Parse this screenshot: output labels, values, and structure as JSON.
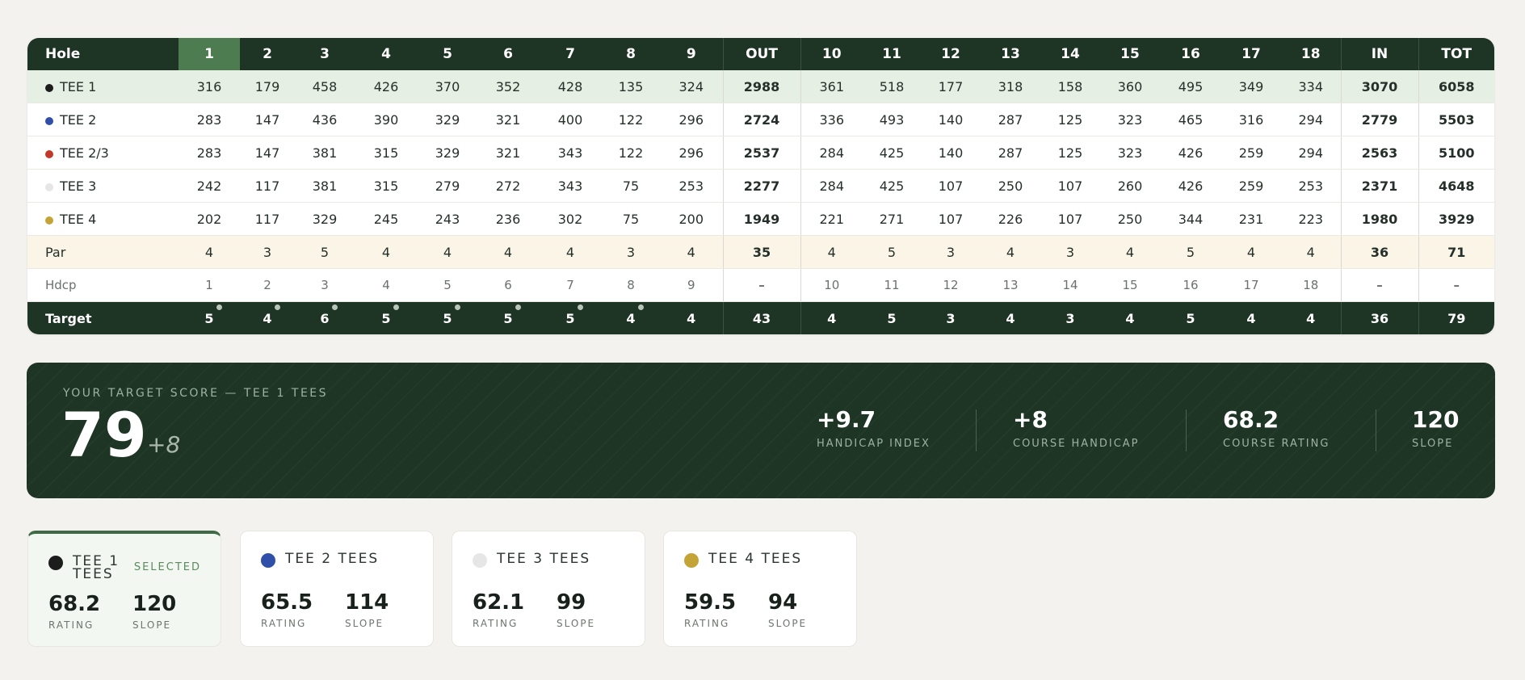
{
  "scorecard": {
    "header": [
      "Hole",
      "1",
      "2",
      "3",
      "4",
      "5",
      "6",
      "7",
      "8",
      "9",
      "OUT",
      "10",
      "11",
      "12",
      "13",
      "14",
      "15",
      "16",
      "17",
      "18",
      "IN",
      "TOT"
    ],
    "tees": [
      {
        "name": "TEE 1",
        "dot": "#1c1c1c",
        "cells": [
          "316",
          "179",
          "458",
          "426",
          "370",
          "352",
          "428",
          "135",
          "324",
          "2988",
          "361",
          "518",
          "177",
          "318",
          "158",
          "360",
          "495",
          "349",
          "334",
          "3070",
          "6058"
        ]
      },
      {
        "name": "TEE 2",
        "dot": "#2f4fa8",
        "cells": [
          "283",
          "147",
          "436",
          "390",
          "329",
          "321",
          "400",
          "122",
          "296",
          "2724",
          "336",
          "493",
          "140",
          "287",
          "125",
          "323",
          "465",
          "316",
          "294",
          "2779",
          "5503"
        ]
      },
      {
        "name": "TEE 2/3",
        "dot": "#c0392b",
        "cells": [
          "283",
          "147",
          "381",
          "315",
          "329",
          "321",
          "343",
          "122",
          "296",
          "2537",
          "284",
          "425",
          "140",
          "287",
          "125",
          "323",
          "426",
          "259",
          "294",
          "2563",
          "5100"
        ]
      },
      {
        "name": "TEE 3",
        "dot": "#e6e6e6",
        "cells": [
          "242",
          "117",
          "381",
          "315",
          "279",
          "272",
          "343",
          "75",
          "253",
          "2277",
          "284",
          "425",
          "107",
          "250",
          "107",
          "260",
          "426",
          "259",
          "253",
          "2371",
          "4648"
        ]
      },
      {
        "name": "TEE 4",
        "dot": "#c4a437",
        "cells": [
          "202",
          "117",
          "329",
          "245",
          "243",
          "236",
          "302",
          "75",
          "200",
          "1949",
          "221",
          "271",
          "107",
          "226",
          "107",
          "250",
          "344",
          "231",
          "223",
          "1980",
          "3929"
        ]
      }
    ],
    "par": {
      "label": "Par",
      "cells": [
        "4",
        "3",
        "5",
        "4",
        "4",
        "4",
        "4",
        "3",
        "4",
        "35",
        "4",
        "5",
        "3",
        "4",
        "3",
        "4",
        "5",
        "4",
        "4",
        "36",
        "71"
      ]
    },
    "hdcp": {
      "label": "Hdcp",
      "cells": [
        "1",
        "2",
        "3",
        "4",
        "5",
        "6",
        "7",
        "8",
        "9",
        "–",
        "10",
        "11",
        "12",
        "13",
        "14",
        "15",
        "16",
        "17",
        "18",
        "–",
        "–"
      ]
    },
    "target": {
      "label": "Target",
      "cells": [
        "5",
        "4",
        "6",
        "5",
        "5",
        "5",
        "5",
        "4",
        "4",
        "43",
        "4",
        "5",
        "3",
        "4",
        "3",
        "4",
        "5",
        "4",
        "4",
        "36",
        "79"
      ]
    }
  },
  "hero": {
    "label": "YOUR TARGET SCORE — TEE 1 TEES",
    "score": "79",
    "delta": "+8",
    "stats": [
      {
        "value": "+9.7",
        "label": "HANDICAP INDEX"
      },
      {
        "value": "+8",
        "label": "COURSE HANDICAP"
      },
      {
        "value": "68.2",
        "label": "COURSE RATING"
      },
      {
        "value": "120",
        "label": "SLOPE"
      }
    ]
  },
  "tee_cards": [
    {
      "name": "TEE 1 TEES",
      "dot": "#1c1c1c",
      "selected_label": "SELECTED",
      "rating": "68.2",
      "slope": "120",
      "rating_label": "RATING",
      "slope_label": "SLOPE"
    },
    {
      "name": "TEE 2 TEES",
      "dot": "#2f4fa8",
      "rating": "65.5",
      "slope": "114",
      "rating_label": "RATING",
      "slope_label": "SLOPE"
    },
    {
      "name": "TEE 3 TEES",
      "dot": "#e6e6e6",
      "rating": "62.1",
      "slope": "99",
      "rating_label": "RATING",
      "slope_label": "SLOPE"
    },
    {
      "name": "TEE 4 TEES",
      "dot": "#c4a437",
      "rating": "59.5",
      "slope": "94",
      "rating_label": "RATING",
      "slope_label": "SLOPE"
    }
  ]
}
